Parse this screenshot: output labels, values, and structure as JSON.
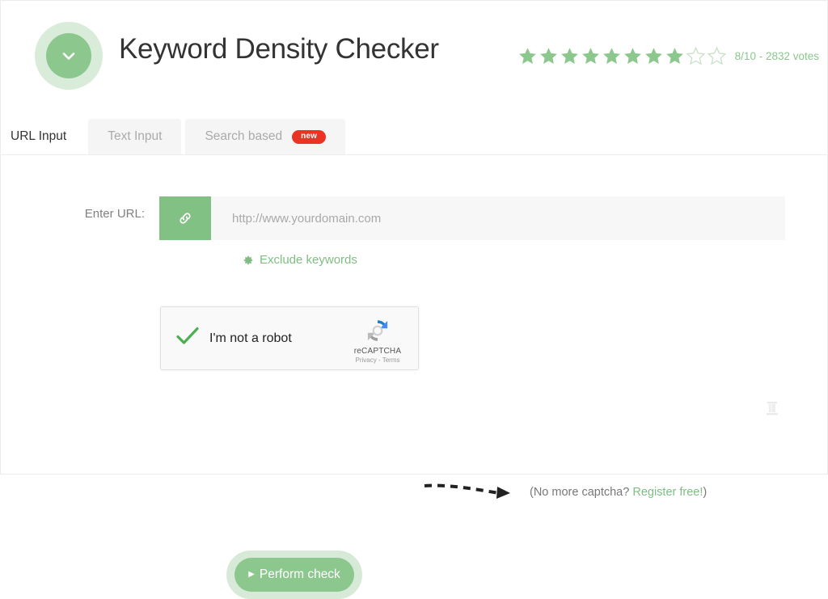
{
  "header": {
    "title": "Keyword Density Checker",
    "logo_icon": "chevron-down-icon",
    "rating": {
      "filled_stars": 8,
      "empty_stars": 2,
      "score_text": "8/10 - 2832 votes",
      "accent_color": "#8cc78e"
    }
  },
  "tabs": [
    {
      "label": "URL Input",
      "active": true,
      "badge": null
    },
    {
      "label": "Text Input",
      "active": false,
      "badge": null
    },
    {
      "label": "Search based",
      "active": false,
      "badge": "new"
    }
  ],
  "form": {
    "url_label": "Enter URL:",
    "url_placeholder": "http://www.yourdomain.com",
    "url_value": "",
    "addon_icon": "link-icon",
    "exclude_label": "Exclude keywords",
    "exclude_icon": "gear-icon"
  },
  "captcha": {
    "checkbox_state": "checked",
    "label": "I'm not a robot",
    "brand_name": "reCAPTCHA",
    "legal": "Privacy - Terms",
    "note_prefix": "(No more captcha? ",
    "note_link": "Register free!",
    "note_suffix": ")"
  },
  "submit": {
    "label": "Perform check",
    "caret_icon": "play-caret-icon"
  },
  "colors": {
    "brand_green": "#8cc78e",
    "addon_green": "#82c184",
    "halo_green": "#d7ead7",
    "badge_red": "#ea3323",
    "input_bg": "#f7f7f7"
  }
}
